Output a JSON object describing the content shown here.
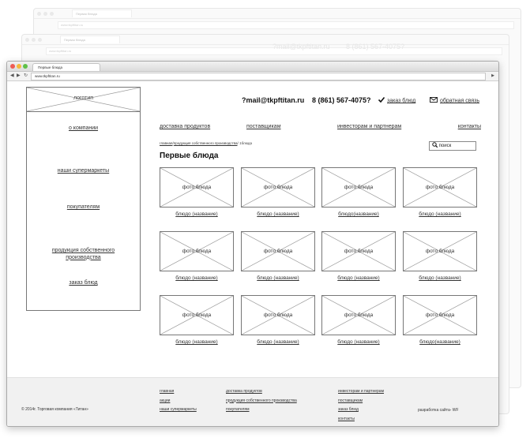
{
  "browser": {
    "tab_title": "Первые блюда",
    "url": "www.tkpftitan.ru",
    "ghost_tab_1": "Первая блюда",
    "ghost_url_1": "www.tkpftitan.ru",
    "ghost_tab_2": "Первая блюда",
    "ghost_url_2": "www.tkpftitan.ru"
  },
  "sidebar": {
    "logo": "логотип",
    "items": [
      "о компании",
      "наши супермаркеты",
      "покупателям",
      "продукция собственного производства",
      "заказ блюд"
    ]
  },
  "header": {
    "email": "?mail@tkpftitan.ru",
    "phone": "8 (861) 567-4075?",
    "order": "заказ блюд",
    "feedback": "обратная связь"
  },
  "topnav": [
    "доставка продуктов",
    "поставщикам",
    "инвесторам и партнерам",
    "контакты"
  ],
  "breadcrumb": {
    "home": "главная",
    "section": "продукция собственного производства",
    "sep": "/",
    "current": "1блюда"
  },
  "search": {
    "placeholder": "поиск"
  },
  "page_title": "Первые блюда",
  "products": [
    {
      "photo": "фото блюда",
      "name": "блюдо (название)"
    },
    {
      "photo": "фото блюда",
      "name": "блюдо (название)"
    },
    {
      "photo": "фото блюда",
      "name": "блюдо(название)"
    },
    {
      "photo": "фото блюда",
      "name": "блюдо (название)"
    },
    {
      "photo": "фото блюда",
      "name": "блюдо (название)"
    },
    {
      "photo": "фото блюда",
      "name": "блюдо (название)"
    },
    {
      "photo": "фото блюда",
      "name": "блюдо (название)"
    },
    {
      "photo": "фото блюда",
      "name": "блюдо (название)"
    },
    {
      "photo": "фото блюда",
      "name": "блюдо (название)"
    },
    {
      "photo": "фото блюда",
      "name": "блюдо (название)"
    },
    {
      "photo": "фото блюда",
      "name": "блюдо (название)"
    },
    {
      "photo": "фото блюда",
      "name": "блюдо(название)"
    }
  ],
  "footer": {
    "col1": [
      "главная",
      "акции",
      "наши супермаркеты"
    ],
    "col2": [
      "доставка продуктов",
      "продукция собственного производства",
      "покупателям"
    ],
    "col3": [
      "инвесторам и партнерам",
      "поставщикам",
      "заказ блюд",
      "контакты"
    ],
    "copyright": "© 2014г. Торговая компания «Титан»",
    "developer": "разработка сайта- WF"
  },
  "ghost_text": {
    "email": "?mail@tkpftitan.ru",
    "phone": "8 (861) 567-4075?"
  }
}
